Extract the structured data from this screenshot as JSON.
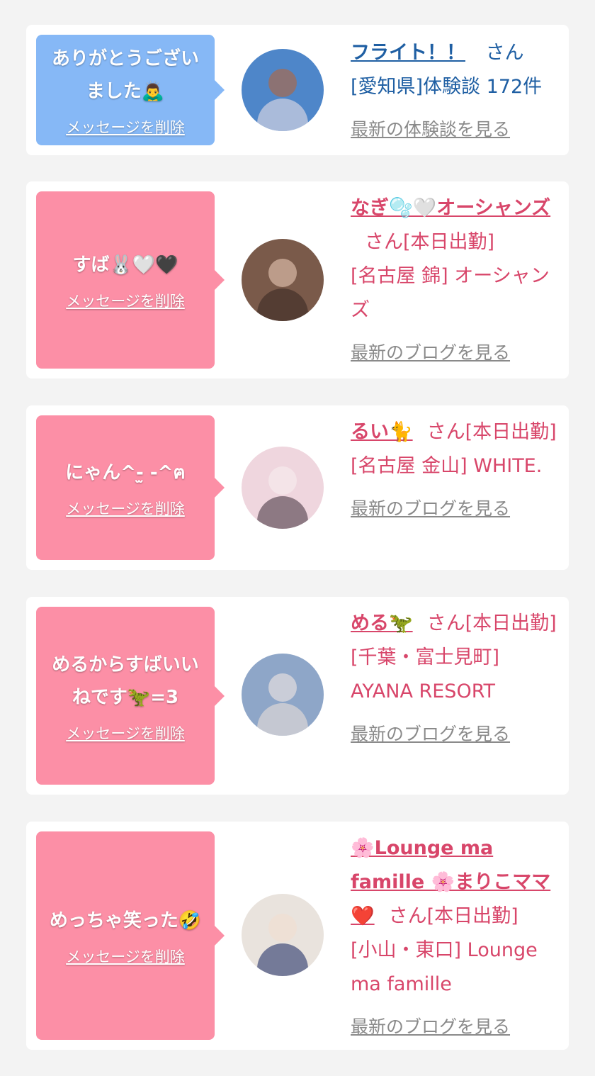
{
  "items": [
    {
      "message": "ありがとうございました🙇‍♂️",
      "delete_label": "メッセージを削除",
      "name": "フライト！！",
      "suffix": "さん",
      "meta": "[愛知県]体験談 172件",
      "more_label": "最新の体験談を見る",
      "colors": {
        "bubble": "#86b8f6",
        "text": "#1f5fa3"
      }
    },
    {
      "message": "すば🐰🤍🖤",
      "delete_label": "メッセージを削除",
      "name": "なぎ🫧🤍オーシャンズ",
      "suffix": "さん[本日出勤]",
      "meta": "[名古屋 錦] オーシャンズ",
      "more_label": "最新のブログを見る",
      "colors": {
        "bubble": "#fc8fa6",
        "text": "#d8466a"
      }
    },
    {
      "message": "にゃん^-̫ -^ฅ",
      "delete_label": "メッセージを削除",
      "name": "るい🐈",
      "suffix": "さん[本日出勤]",
      "meta": "[名古屋 金山] WHITE.",
      "more_label": "最新のブログを見る",
      "colors": {
        "bubble": "#fc8fa6",
        "text": "#d8466a"
      }
    },
    {
      "message": "めるからすばいいねです🦖=3",
      "delete_label": "メッセージを削除",
      "name": "める🦖",
      "suffix": "さん[本日出勤]",
      "meta": "[千葉・富士見町] AYANA RESORT",
      "more_label": "最新のブログを見る",
      "colors": {
        "bubble": "#fc8fa6",
        "text": "#d8466a"
      }
    },
    {
      "message": "めっちゃ笑った🤣",
      "delete_label": "メッセージを削除",
      "name": "🌸Lounge ma famille 🌸まりこママ❤️",
      "suffix": "さん[本日出勤]",
      "meta": "[小山・東口] Lounge ma famille",
      "more_label": "最新のブログを見る",
      "colors": {
        "bubble": "#fc8fa6",
        "text": "#d8466a"
      }
    }
  ]
}
